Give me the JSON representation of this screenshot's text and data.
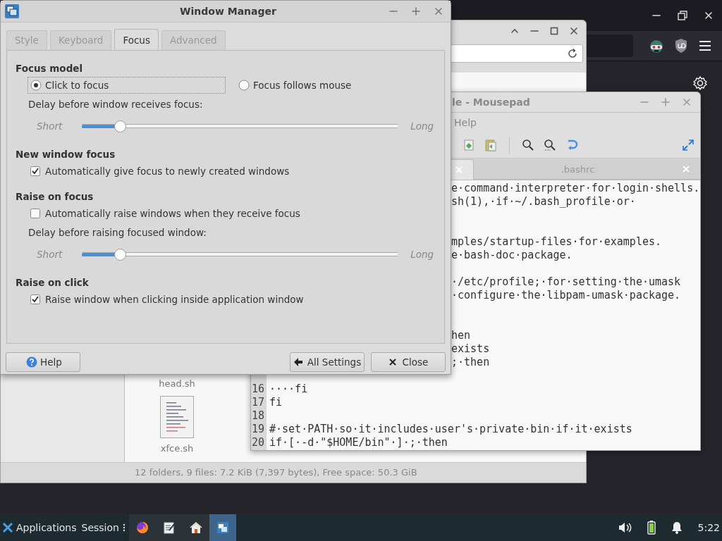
{
  "file_manager": {
    "files": [
      {
        "name": "head.sh"
      },
      {
        "name": "xfce.sh"
      }
    ],
    "status_bar": "12 folders, 9 files: 7.2 KiB (7,397 bytes), Free space: 50.3 GiB"
  },
  "mousepad": {
    "title": "le - Mousepad",
    "menu": [
      "Help"
    ],
    "tabs": [
      {
        "selected": true
      },
      {
        "label": ".bashrc",
        "selected": false
      }
    ],
    "lines": [
      {
        "kind": "partial",
        "text": "e·command·interpreter·for·login·shells."
      },
      {
        "kind": "partial",
        "text": "sh(1),·if·~/.bash_profile·or·"
      },
      {
        "kind": "blank"
      },
      {
        "kind": "blank"
      },
      {
        "kind": "partial",
        "text": "mples/startup-files·for·examples."
      },
      {
        "kind": "partial",
        "text": "e·bash-doc·package."
      },
      {
        "kind": "blank"
      },
      {
        "kind": "partial",
        "text": "·/etc/profile;·for·setting·the·umask"
      },
      {
        "kind": "partial",
        "text": "·configure·the·libpam-umask·package."
      },
      {
        "kind": "blank"
      },
      {
        "kind": "blank"
      },
      {
        "kind": "partial",
        "text": "hen"
      },
      {
        "kind": "partial",
        "text": "exists"
      },
      {
        "kind": "partial",
        "text": ";·then"
      },
      {
        "kind": "blank"
      },
      {
        "kind": "full",
        "number": "16",
        "text": "····fi"
      },
      {
        "kind": "full",
        "number": "17",
        "text": "fi"
      },
      {
        "kind": "full",
        "number": "18"
      },
      {
        "kind": "full",
        "number": "19",
        "text": "#·set·PATH·so·it·includes·user's·private·bin·if·it·exists"
      },
      {
        "kind": "full",
        "number": "20",
        "text": "if·[·-d·\"$HOME/bin\"·]·;·then"
      }
    ]
  },
  "window_manager": {
    "title": "Window Manager",
    "tabs": [
      {
        "label": "Style",
        "selected": false
      },
      {
        "label": "Keyboard",
        "selected": false
      },
      {
        "label": "Focus",
        "selected": true
      },
      {
        "label": "Advanced",
        "selected": false
      }
    ],
    "sections": [
      {
        "heading": "Focus model",
        "items": [
          {
            "kind": "radios",
            "options": [
              {
                "label": "Click to focus",
                "selected": true,
                "focused": true
              },
              {
                "label": "Focus follows mouse",
                "selected": false,
                "focused": false
              }
            ]
          },
          {
            "kind": "slider",
            "label": "Delay before window receives focus:",
            "min_label": "Short",
            "max_label": "Long",
            "level": 0.12
          }
        ]
      },
      {
        "heading": "New window focus",
        "items": [
          {
            "kind": "checkbox",
            "label": "Automatically give focus to newly created windows",
            "checked": true
          }
        ]
      },
      {
        "heading": "Raise on focus",
        "items": [
          {
            "kind": "checkbox",
            "label": "Automatically raise windows when they receive focus",
            "checked": false
          },
          {
            "kind": "slider",
            "label": "Delay before raising focused window:",
            "min_label": "Short",
            "max_label": "Long",
            "level": 0.12
          }
        ]
      },
      {
        "heading": "Raise on click",
        "items": [
          {
            "kind": "checkbox",
            "label": "Raise window when clicking inside application window",
            "checked": true
          }
        ]
      }
    ],
    "buttons": [
      {
        "kind": "help",
        "label": "Help"
      },
      {
        "kind": "settings",
        "label": "All Settings"
      },
      {
        "kind": "close",
        "label": "Close"
      }
    ]
  },
  "taskbar": {
    "menus": [
      {
        "kind": "applications",
        "label": "Applications"
      },
      {
        "kind": "session",
        "label": "Session"
      }
    ],
    "apps": [
      {
        "kind": "firefox",
        "selected": false
      },
      {
        "kind": "editor",
        "selected": false
      },
      {
        "kind": "home",
        "selected": false
      },
      {
        "kind": "window-manager",
        "selected": true
      }
    ],
    "clock": "5:22"
  }
}
